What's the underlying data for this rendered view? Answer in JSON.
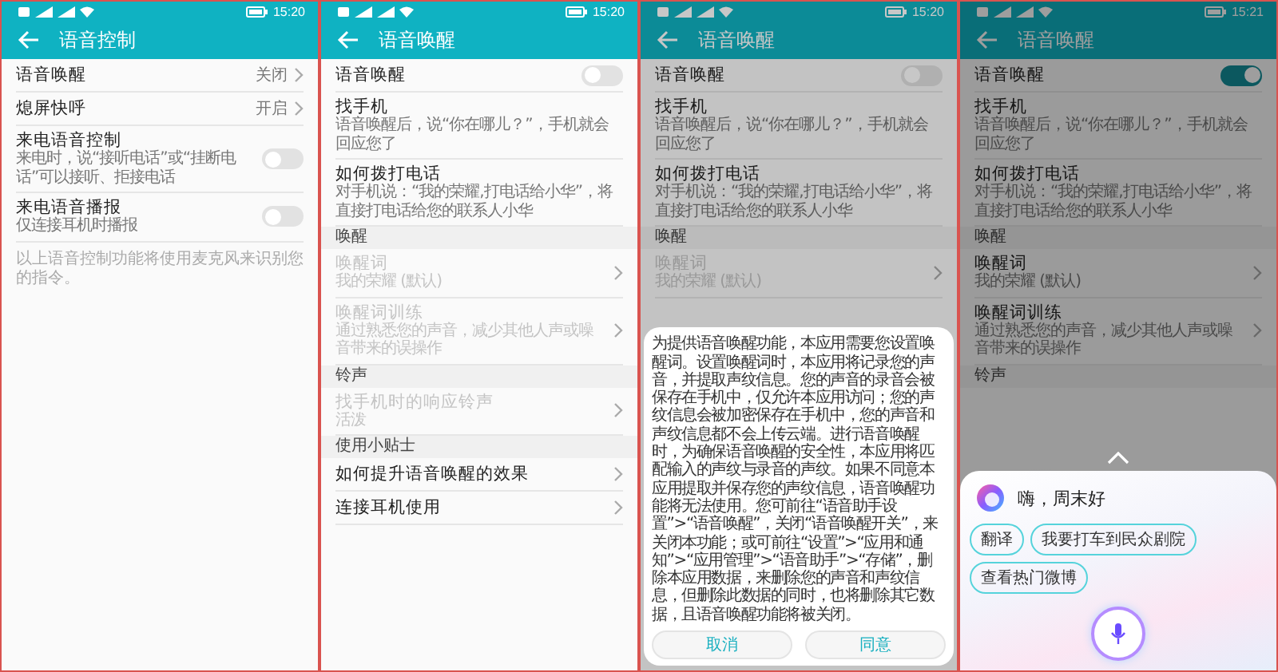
{
  "screens": [
    {
      "time": "15:20",
      "title": "语音控制",
      "items": [
        {
          "kind": "value",
          "title": "语音唤醒",
          "value": "关闭",
          "disabled": false
        },
        {
          "kind": "value",
          "title": "熄屏快呼",
          "value": "开启",
          "disabled": false
        },
        {
          "kind": "toggle",
          "title": "来电语音控制",
          "subtitle": "来电时，说“接听电话”或“挂断电话”可以接听、拒接电话",
          "on": false,
          "disabled": false
        },
        {
          "kind": "toggle",
          "title": "来电语音播报",
          "subtitle": "仅连接耳机时播报",
          "on": false,
          "disabled": false
        },
        {
          "kind": "note",
          "title": "以上语音控制功能将使用麦克风来识别您的指令。"
        }
      ]
    },
    {
      "time": "15:20",
      "title": "语音唤醒",
      "items": [
        {
          "kind": "toggle",
          "title": "语音唤醒",
          "on": false,
          "disabled": false
        },
        {
          "kind": "text",
          "title": "找手机",
          "subtitle": "语音唤醒后，说“你在哪儿？”，手机就会回应您了",
          "disabled": false
        },
        {
          "kind": "text",
          "title": "如何拨打电话",
          "subtitle": "对手机说：“我的荣耀,打电话给小华”，将直接打电话给您的联系人小华",
          "disabled": false
        },
        {
          "kind": "header",
          "title": "唤醒"
        },
        {
          "kind": "link",
          "title": "唤醒词",
          "subtitle": "我的荣耀 (默认)",
          "disabled": true
        },
        {
          "kind": "link",
          "title": "唤醒词训练",
          "subtitle": "通过熟悉您的声音，减少其他人声或噪音带来的误操作",
          "disabled": true
        },
        {
          "kind": "header",
          "title": "铃声"
        },
        {
          "kind": "link",
          "title": "找手机时的响应铃声",
          "subtitle": "活泼",
          "disabled": true
        },
        {
          "kind": "header",
          "title": "使用小贴士"
        },
        {
          "kind": "link",
          "title": "如何提升语音唤醒的效果",
          "disabled": false
        },
        {
          "kind": "link",
          "title": "连接耳机使用",
          "disabled": false
        }
      ]
    },
    {
      "time": "15:20",
      "title": "语音唤醒",
      "items": [
        {
          "kind": "toggle",
          "title": "语音唤醒",
          "on": false,
          "disabled": false
        },
        {
          "kind": "text",
          "title": "找手机",
          "subtitle": "语音唤醒后，说“你在哪儿？”，手机就会回应您了",
          "disabled": false
        },
        {
          "kind": "text",
          "title": "如何拨打电话",
          "subtitle": "对手机说：“我的荣耀,打电话给小华”，将直接打电话给您的联系人小华",
          "disabled": false
        },
        {
          "kind": "header",
          "title": "唤醒"
        },
        {
          "kind": "link",
          "title": "唤醒词",
          "subtitle": "我的荣耀 (默认)",
          "disabled": true
        }
      ],
      "overlay": {
        "kind": "dialog",
        "text": "为提供语音唤醒功能，本应用需要您设置唤醒词。设置唤醒词时，本应用将记录您的声音，并提取声纹信息。您的声音的录音会被保存在手机中，仅允许本应用访问；您的声纹信息会被加密保存在手机中，您的声音和声纹信息都不会上传云端。进行语音唤醒时，为确保语音唤醒的安全性，本应用将匹配输入的声纹与录音的声纹。如果不同意本应用提取并保存您的声纹信息，语音唤醒功能将无法使用。您可前往“语音助手设置”>“语音唤醒”，关闭“语音唤醒开关”，来关闭本功能；或可前往“设置”>“应用和通知”>“应用管理”>“语音助手”>“存储”，删除本应用数据，来删除您的声音和声纹信息，但删除此数据的同时，也将删除其它数据，且语音唤醒功能将被关闭。",
        "buttons": [
          "取消",
          "同意"
        ]
      }
    },
    {
      "time": "15:21",
      "title": "语音唤醒",
      "items": [
        {
          "kind": "toggle",
          "title": "语音唤醒",
          "on": true,
          "disabled": false
        },
        {
          "kind": "text",
          "title": "找手机",
          "subtitle": "语音唤醒后，说“你在哪儿？”，手机就会回应您了",
          "disabled": false
        },
        {
          "kind": "text",
          "title": "如何拨打电话",
          "subtitle": "对手机说：“我的荣耀,打电话给小华”，将直接打电话给您的联系人小华",
          "disabled": false
        },
        {
          "kind": "header",
          "title": "唤醒"
        },
        {
          "kind": "link",
          "title": "唤醒词",
          "subtitle": "我的荣耀 (默认)",
          "disabled": false
        },
        {
          "kind": "link",
          "title": "唤醒词训练",
          "subtitle": "通过熟悉您的声音，减少其他人声或噪音带来的误操作",
          "disabled": false
        },
        {
          "kind": "header",
          "title": "铃声"
        }
      ],
      "overlay": {
        "kind": "assistant",
        "greeting": "嗨，周末好",
        "chips": [
          "翻译",
          "我要打车到民众剧院",
          "查看热门微博"
        ]
      }
    }
  ]
}
